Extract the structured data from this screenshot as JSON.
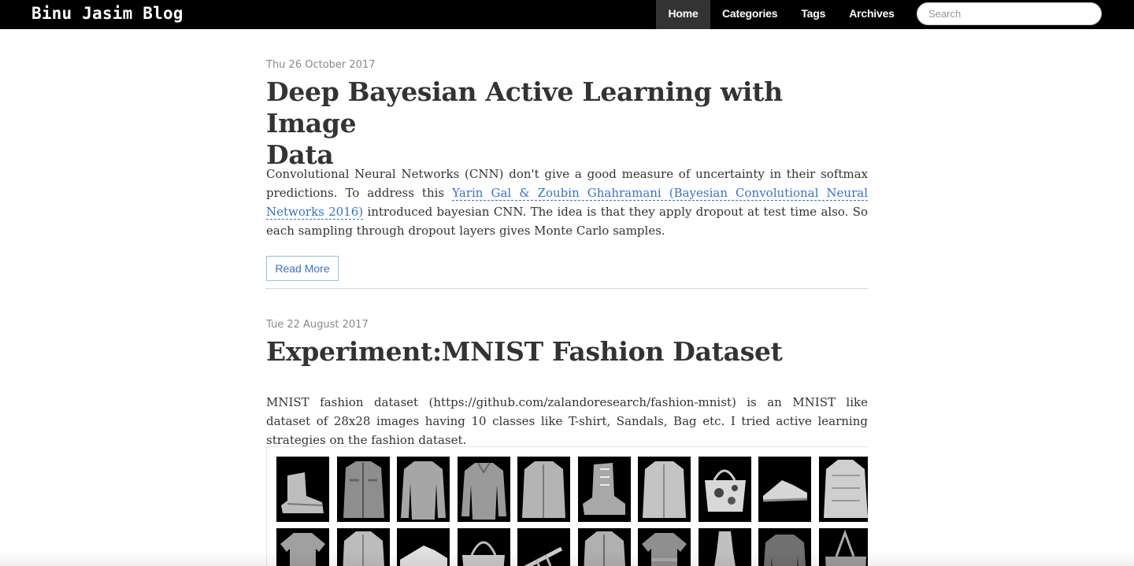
{
  "site": {
    "brand": "Binu Jasim Blog"
  },
  "nav": {
    "items": [
      {
        "label": "Home",
        "active": true
      },
      {
        "label": "Categories",
        "active": false
      },
      {
        "label": "Tags",
        "active": false
      },
      {
        "label": "Archives",
        "active": false
      }
    ],
    "search_placeholder": "Search"
  },
  "posts": [
    {
      "date": "Thu 26 October 2017",
      "title_line1": "Deep Bayesian Active Learning with Image",
      "title_line2": "Data",
      "body_before_link": "Convolutional Neural Networks (CNN) don't give a good measure of uncertainty in their softmax predictions. To address this ",
      "link_text": "Yarin Gal & Zoubin Ghahramani (Bayesian Convolutional Neural Networks 2016)",
      "body_after_link": " introduced bayesian CNN. The idea is that they apply dropout at test time also. So each sampling through dropout layers gives Monte Carlo samples.",
      "read_more": "Read More"
    },
    {
      "date": "Tue 22 August 2017",
      "title": "Experiment:MNIST Fashion Dataset",
      "body": "MNIST fashion dataset (https://github.com/zalandoresearch/fashion-mnist) is an MNIST like dataset of 28x28 images having 10 classes like T-shirt, Sandals, Bag etc. I tried active learning strategies on the fashion dataset."
    }
  ],
  "fashion_grid": {
    "row1": [
      "ankle-boot",
      "shirt",
      "pullover",
      "pullover",
      "coat",
      "ankle-boot",
      "coat",
      "bag",
      "sneaker",
      "coat"
    ],
    "row2": [
      "t-shirt",
      "coat",
      "sneaker",
      "bag",
      "sandal",
      "coat",
      "t-shirt",
      "dress",
      "pullover",
      "bag"
    ]
  },
  "colors": {
    "navbar_bg": "#000000",
    "nav_active_bg": "#333333",
    "link": "#3a6fc9",
    "date": "#8a8a8a",
    "text": "#333333",
    "read_more_border": "#8fc7e0"
  }
}
